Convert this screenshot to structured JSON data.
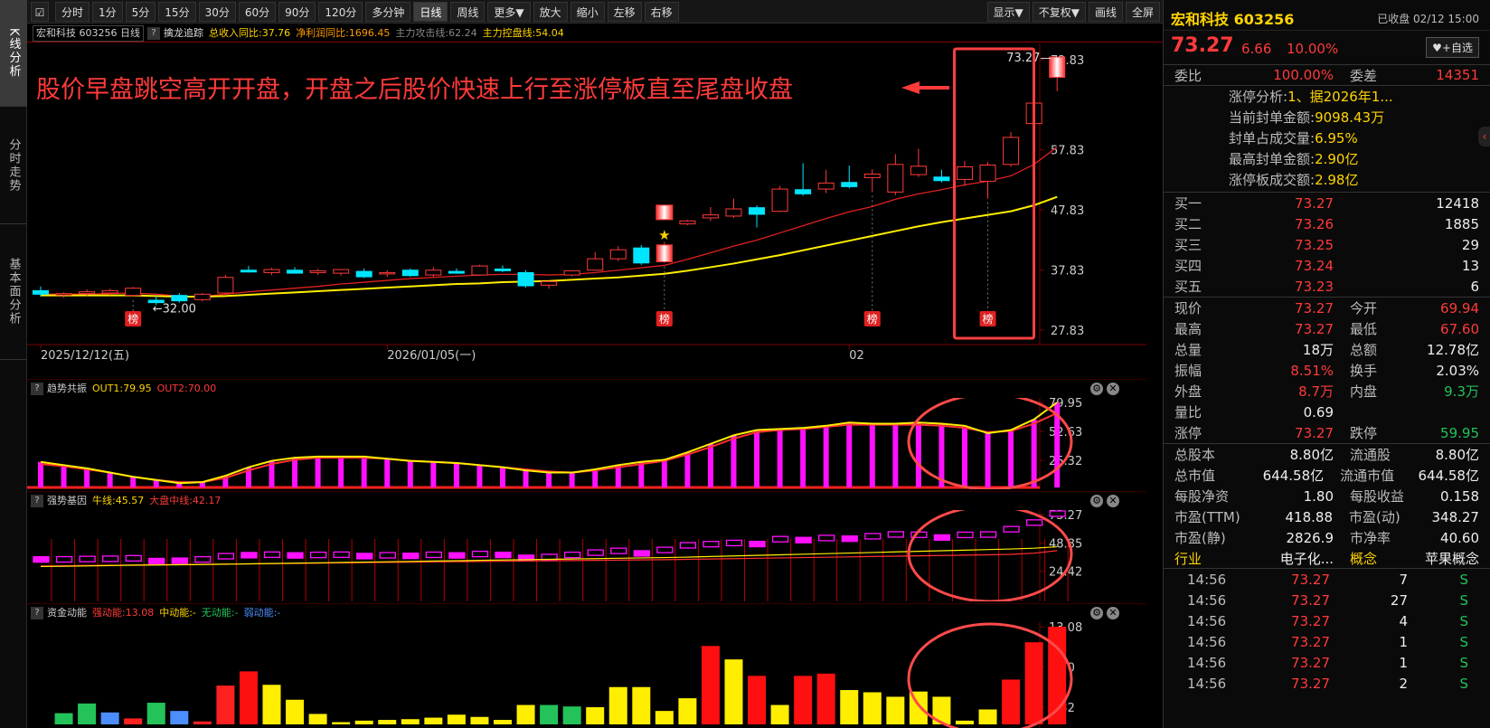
{
  "sidebar": {
    "tabs": [
      "K线分析",
      "分时走势",
      "基本面分析"
    ]
  },
  "toolbar": {
    "square_icon": "gear-icon",
    "periods": [
      "分时",
      "1分",
      "5分",
      "15分",
      "30分",
      "60分",
      "90分",
      "120分",
      "多分钟",
      "日线",
      "周线",
      "更多▼",
      "放大",
      "缩小",
      "左移",
      "右移"
    ],
    "active": "日线",
    "right": [
      "显示▼",
      "不复权▼",
      "画线",
      "全屏"
    ]
  },
  "info_bar": {
    "code_label": "宏和科技 603256 日线",
    "indicator": "擒龙追踪",
    "income_yoy": "总收入同比:37.76",
    "profit_yoy": "净利润同比:1696.45",
    "attack_line": "主力攻击线:62.24",
    "control_line": "主力控盘线:54.04"
  },
  "main_chart": {
    "annotation": "股价早盘跳空高开开盘，开盘之后股价快速上行至涨停板直至尾盘收盘",
    "y_ticks": [
      "72.83",
      "57.83",
      "47.83",
      "37.83",
      "27.83"
    ],
    "x_ticks": [
      "2025/12/12(五)",
      "2026/01/05(一)",
      "02"
    ],
    "low_label": "32.00",
    "high_label": "73.27",
    "badge": "榜",
    "colors": {
      "up": "#ff3a3a",
      "down": "#00e5ff",
      "ma_red": "#e02020",
      "ma_yellow": "#ffee00",
      "annotation": "#ff3a3a"
    }
  },
  "chart_data": [
    {
      "type": "candlestick",
      "y_range": [
        27.83,
        72.83
      ],
      "candles": [
        {
          "o": 34.4,
          "h": 35.1,
          "l": 33.4,
          "c": 33.8
        },
        {
          "o": 33.7,
          "h": 34.1,
          "l": 33.2,
          "c": 33.9
        },
        {
          "o": 33.9,
          "h": 34.6,
          "l": 33.5,
          "c": 34.2
        },
        {
          "o": 34.0,
          "h": 34.7,
          "l": 33.6,
          "c": 34.4
        },
        {
          "o": 33.6,
          "h": 35.0,
          "l": 33.4,
          "c": 34.8
        },
        {
          "o": 32.8,
          "h": 33.5,
          "l": 32.0,
          "c": 32.4
        },
        {
          "o": 33.6,
          "h": 34.0,
          "l": 32.4,
          "c": 32.7
        },
        {
          "o": 32.9,
          "h": 34.0,
          "l": 32.6,
          "c": 33.8
        },
        {
          "o": 34.0,
          "h": 37.0,
          "l": 33.8,
          "c": 36.6
        },
        {
          "o": 37.8,
          "h": 38.5,
          "l": 37.4,
          "c": 37.5
        },
        {
          "o": 37.4,
          "h": 38.2,
          "l": 37.0,
          "c": 37.9
        },
        {
          "o": 37.8,
          "h": 38.3,
          "l": 37.3,
          "c": 37.3
        },
        {
          "o": 37.4,
          "h": 38.0,
          "l": 37.0,
          "c": 37.7
        },
        {
          "o": 37.3,
          "h": 38.0,
          "l": 36.9,
          "c": 37.9
        },
        {
          "o": 37.6,
          "h": 38.1,
          "l": 36.5,
          "c": 36.7
        },
        {
          "o": 37.2,
          "h": 37.8,
          "l": 36.7,
          "c": 37.4
        },
        {
          "o": 37.8,
          "h": 38.1,
          "l": 36.7,
          "c": 36.9
        },
        {
          "o": 37.0,
          "h": 38.3,
          "l": 36.7,
          "c": 37.8
        },
        {
          "o": 37.6,
          "h": 38.1,
          "l": 37.2,
          "c": 37.3
        },
        {
          "o": 37.0,
          "h": 38.7,
          "l": 36.9,
          "c": 38.5
        },
        {
          "o": 38.0,
          "h": 38.6,
          "l": 37.5,
          "c": 37.7
        },
        {
          "o": 37.4,
          "h": 37.8,
          "l": 34.9,
          "c": 35.2
        },
        {
          "o": 35.3,
          "h": 36.0,
          "l": 34.7,
          "c": 35.9
        },
        {
          "o": 37.0,
          "h": 37.8,
          "l": 36.8,
          "c": 37.7
        },
        {
          "o": 37.8,
          "h": 40.8,
          "l": 37.7,
          "c": 39.7
        },
        {
          "o": 39.7,
          "h": 41.8,
          "l": 39.3,
          "c": 41.2
        },
        {
          "o": 41.5,
          "h": 42.0,
          "l": 38.7,
          "c": 39.0
        },
        {
          "o": 39.2,
          "h": 42.5,
          "l": 39.0,
          "c": 42.0
        },
        {
          "o": 45.5,
          "h": 46.2,
          "l": 45.3,
          "c": 46.0
        },
        {
          "o": 46.5,
          "h": 48.3,
          "l": 46.0,
          "c": 47.0
        },
        {
          "o": 46.8,
          "h": 49.7,
          "l": 46.5,
          "c": 48.0
        },
        {
          "o": 48.2,
          "h": 48.6,
          "l": 44.9,
          "c": 47.1
        },
        {
          "o": 47.6,
          "h": 51.8,
          "l": 47.5,
          "c": 51.3
        },
        {
          "o": 51.2,
          "h": 55.6,
          "l": 50.2,
          "c": 50.5
        },
        {
          "o": 51.3,
          "h": 54.5,
          "l": 50.6,
          "c": 52.3
        },
        {
          "o": 52.4,
          "h": 55.2,
          "l": 51.4,
          "c": 51.7
        },
        {
          "o": 53.2,
          "h": 54.6,
          "l": 50.8,
          "c": 53.8
        },
        {
          "o": 50.8,
          "h": 57.1,
          "l": 50.3,
          "c": 55.4
        },
        {
          "o": 53.7,
          "h": 58.0,
          "l": 53.3,
          "c": 55.1
        },
        {
          "o": 53.3,
          "h": 54.5,
          "l": 52.4,
          "c": 52.7
        },
        {
          "o": 52.9,
          "h": 56.0,
          "l": 51.8,
          "c": 55.0
        },
        {
          "o": 52.6,
          "h": 55.8,
          "l": 49.7,
          "c": 55.3
        },
        {
          "o": 55.4,
          "h": 60.8,
          "l": 55.0,
          "c": 59.9
        },
        {
          "o": 62.2,
          "h": 65.9,
          "l": 61.0,
          "c": 65.6
        },
        {
          "o": 69.9,
          "h": 73.27,
          "l": 67.6,
          "c": 73.27
        }
      ],
      "ma": [
        {
          "name": "MA_red",
          "values": [
            33.8,
            33.8,
            33.8,
            33.9,
            34.0,
            33.8,
            33.5,
            33.4,
            33.8,
            34.2,
            34.5,
            34.8,
            35.1,
            35.5,
            35.8,
            36.1,
            36.4,
            36.6,
            36.8,
            37.0,
            37.1,
            37.1,
            37.0,
            37.1,
            37.4,
            37.8,
            38.2,
            38.6,
            39.6,
            40.7,
            41.8,
            42.8,
            44.0,
            45.2,
            46.4,
            47.5,
            48.4,
            49.6,
            50.5,
            51.2,
            52.0,
            52.6,
            53.5,
            55.4,
            58.3
          ]
        },
        {
          "name": "MA_yellow",
          "values": [
            33.6,
            33.6,
            33.6,
            33.6,
            33.6,
            33.5,
            33.4,
            33.4,
            33.5,
            33.7,
            33.9,
            34.1,
            34.3,
            34.5,
            34.7,
            34.9,
            35.1,
            35.3,
            35.5,
            35.6,
            35.8,
            35.9,
            36.0,
            36.2,
            36.4,
            36.6,
            36.9,
            37.2,
            37.7,
            38.3,
            38.9,
            39.6,
            40.3,
            41.1,
            41.9,
            42.7,
            43.5,
            44.3,
            45.1,
            45.8,
            46.4,
            47.0,
            47.6,
            48.6,
            50.0
          ]
        }
      ]
    },
    {
      "type": "bar",
      "title": "趋势共振",
      "y_ticks": [
        "79.95",
        "52.63",
        "25.32"
      ],
      "y_range": [
        0,
        79.95
      ],
      "series": [
        {
          "name": "OUT1",
          "label": "OUT1:79.95",
          "values": [
            24,
            21,
            18,
            14,
            10,
            7,
            4,
            5,
            11,
            19,
            25,
            28,
            29,
            29,
            29,
            27,
            25,
            24,
            23,
            21,
            19,
            16,
            14,
            14,
            17,
            21,
            24,
            26,
            33,
            41,
            49,
            54,
            55,
            56,
            58,
            61,
            60,
            60,
            61,
            60,
            58,
            51,
            54,
            64,
            79.95
          ]
        },
        {
          "name": "OUT2",
          "label": "OUT2:70.00",
          "values": [
            22,
            20,
            17,
            14,
            10,
            7,
            5,
            5,
            9,
            16,
            22,
            26,
            28,
            28,
            28,
            27,
            25,
            24,
            23,
            21,
            19,
            17,
            15,
            14,
            16,
            19,
            22,
            25,
            31,
            38,
            46,
            52,
            54,
            55,
            57,
            59,
            59,
            59,
            59,
            58,
            56,
            52,
            53,
            60,
            70
          ]
        }
      ]
    },
    {
      "type": "bar",
      "title": "强势基因",
      "y_ticks": [
        "73.27",
        "48.85",
        "24.42"
      ],
      "y_range": [
        0,
        73.27
      ],
      "series": [
        {
          "name": "牛线",
          "label": "牛线:45.57",
          "values": [
            28.5,
            28.7,
            29,
            29.3,
            29.6,
            29.8,
            30,
            30.2,
            30.5,
            30.8,
            31.1,
            31.4,
            31.7,
            32,
            32.3,
            32.6,
            32.9,
            33.2,
            33.5,
            33.8,
            34.1,
            34.4,
            34.7,
            35,
            35.3,
            35.6,
            35.9,
            36.2,
            36.6,
            37.1,
            37.6,
            38.1,
            38.6,
            39.1,
            39.6,
            40.1,
            40.6,
            41.1,
            41.6,
            42.1,
            42.6,
            43.1,
            43.6,
            44.3,
            45.57
          ]
        },
        {
          "name": "大盘中线",
          "label": "大盘中线:42.17",
          "values": [
            29,
            29.2,
            29.4,
            29.6,
            29.8,
            30,
            30.2,
            30.4,
            30.6,
            30.8,
            31,
            31.2,
            31.4,
            31.6,
            31.8,
            32,
            32.2,
            32.4,
            32.6,
            32.8,
            33,
            33.2,
            33.4,
            33.6,
            33.8,
            34,
            34.2,
            34.4,
            34.7,
            35,
            35.3,
            35.6,
            35.9,
            36.2,
            36.5,
            36.8,
            37.1,
            37.4,
            37.7,
            38,
            38.3,
            38.6,
            39,
            40,
            42.17
          ]
        }
      ]
    },
    {
      "type": "bar",
      "title": "资金动能",
      "y_ticks": [
        "13.08",
        "7.70",
        "2.32"
      ],
      "y_range": [
        0,
        13.08
      ],
      "series": [
        {
          "name": "强动能",
          "label": "强动能:13.08",
          "values": [
            1.5,
            2.8,
            1.6,
            0.8,
            2.9,
            1.8,
            0.4,
            5.2,
            7.1,
            5.3,
            3.3,
            1.4,
            0.3,
            0.5,
            0.6,
            0.7,
            0.9,
            1.3,
            1.0,
            0.6,
            2.6,
            2.6,
            2.4,
            2.3,
            5.0,
            5.0,
            1.8,
            3.5,
            10.5,
            8.7,
            6.5,
            2.6,
            6.5,
            6.8,
            4.6,
            4.3,
            3.7,
            4.4,
            3.7,
            0.5,
            2.0,
            6.0,
            11.0,
            13.08
          ]
        },
        {
          "name": "中动能",
          "label": "中动能:-"
        },
        {
          "name": "无动能",
          "label": "无动能:-"
        },
        {
          "name": "弱动能",
          "label": "弱动能:-"
        }
      ]
    }
  ],
  "sub_panel_icons": [
    "gear-icon",
    "close-icon"
  ],
  "right_panel": {
    "stock_name": "宏和科技 603256",
    "status": "已收盘 02/12 15:00",
    "price": "73.27",
    "change": "6.66",
    "change_pct": "10.00%",
    "fav_label": "♥+自选",
    "weibi_label": "委比",
    "weibi": "100.00%",
    "weicha_label": "委差",
    "weicha": "14351",
    "limit_analysis": [
      {
        "label": "涨停分析:",
        "value": "1、据2026年1..."
      },
      {
        "label": "当前封单金额:",
        "value": "9098.43万"
      },
      {
        "label": "封单占成交量:",
        "value": "6.95%"
      },
      {
        "label": "最高封单金额:",
        "value": "2.90亿"
      },
      {
        "label": "涨停板成交额:",
        "value": "2.98亿"
      }
    ],
    "bids": [
      {
        "label": "买一",
        "price": "73.27",
        "vol": "12418"
      },
      {
        "label": "买二",
        "price": "73.26",
        "vol": "1885"
      },
      {
        "label": "买三",
        "price": "73.25",
        "vol": "29"
      },
      {
        "label": "买四",
        "price": "73.24",
        "vol": "13"
      },
      {
        "label": "买五",
        "price": "73.23",
        "vol": "6"
      }
    ],
    "quote": [
      [
        "现价",
        "73.27",
        "今开",
        "69.94"
      ],
      [
        "最高",
        "73.27",
        "最低",
        "67.60"
      ],
      [
        "总量",
        "18万",
        "总额",
        "12.78亿"
      ],
      [
        "振幅",
        "8.51%",
        "换手",
        "2.03%"
      ],
      [
        "外盘",
        "8.7万",
        "内盘",
        "9.3万"
      ],
      [
        "量比",
        "0.69",
        "",
        ""
      ],
      [
        "涨停",
        "73.27",
        "跌停",
        "59.95"
      ]
    ],
    "fundamentals": [
      [
        "总股本",
        "8.80亿",
        "流通股",
        "8.80亿"
      ],
      [
        "总市值",
        "644.58亿",
        "流通市值",
        "644.58亿"
      ],
      [
        "每股净资",
        "1.80",
        "每股收益",
        "0.158"
      ],
      [
        "市盈(TTM)",
        "418.88",
        "市盈(动)",
        "348.27"
      ],
      [
        "市盈(静)",
        "2826.9",
        "市净率",
        "40.60"
      ]
    ],
    "sector": {
      "label1": "行业",
      "value1": "电子化...",
      "label2": "概念",
      "value2": "苹果概念"
    },
    "ticks": [
      [
        "14:56",
        "73.27",
        "7",
        "S"
      ],
      [
        "14:56",
        "73.27",
        "27",
        "S"
      ],
      [
        "14:56",
        "73.27",
        "4",
        "S"
      ],
      [
        "14:56",
        "73.27",
        "1",
        "S"
      ],
      [
        "14:56",
        "73.27",
        "1",
        "S"
      ],
      [
        "14:56",
        "73.27",
        "2",
        "S"
      ]
    ]
  }
}
